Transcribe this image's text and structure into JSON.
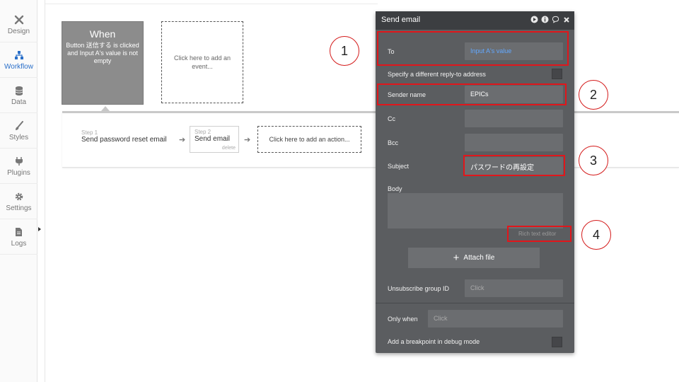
{
  "sidebar": {
    "items": [
      {
        "label": "Design",
        "icon": "design-tools-icon"
      },
      {
        "label": "Workflow",
        "icon": "workflow-tree-icon",
        "active": true
      },
      {
        "label": "Data",
        "icon": "database-icon"
      },
      {
        "label": "Styles",
        "icon": "brush-icon"
      },
      {
        "label": "Plugins",
        "icon": "plug-icon"
      },
      {
        "label": "Settings",
        "icon": "gear-icon"
      },
      {
        "label": "Logs",
        "icon": "document-icon"
      }
    ]
  },
  "event": {
    "title": "When",
    "description": "Button 送信する is clicked and Input A's value is not empty",
    "add_event": "Click here to add an event..."
  },
  "actions": {
    "step1_num": "Step 1",
    "step1_name": "Send password reset email",
    "step2_num": "Step 2",
    "step2_name": "Send email",
    "step2_delete": "delete",
    "add_action": "Click here to add an action..."
  },
  "editor": {
    "title": "Send email",
    "to_label": "To",
    "to_value": "Input A's value",
    "reply_to_label": "Specify a different reply-to address",
    "sender_label": "Sender name",
    "sender_value": "EPICs",
    "cc_label": "Cc",
    "bcc_label": "Bcc",
    "subject_label": "Subject",
    "subject_value": "パスワードの再設定",
    "body_label": "Body",
    "rich_text": "Rich text editor",
    "attach_label": "Attach file",
    "unsubscribe_label": "Unsubscribe group ID",
    "unsubscribe_placeholder": "Click",
    "only_when_label": "Only when",
    "only_when_placeholder": "Click",
    "breakpoint_label": "Add a breakpoint in debug mode"
  },
  "annotations": [
    "1",
    "2",
    "3",
    "4"
  ],
  "colors": {
    "accent": "#2a6fc9",
    "highlight": "#e1161b",
    "panel": "#5b5d60",
    "link_blue": "#62a8ff"
  }
}
